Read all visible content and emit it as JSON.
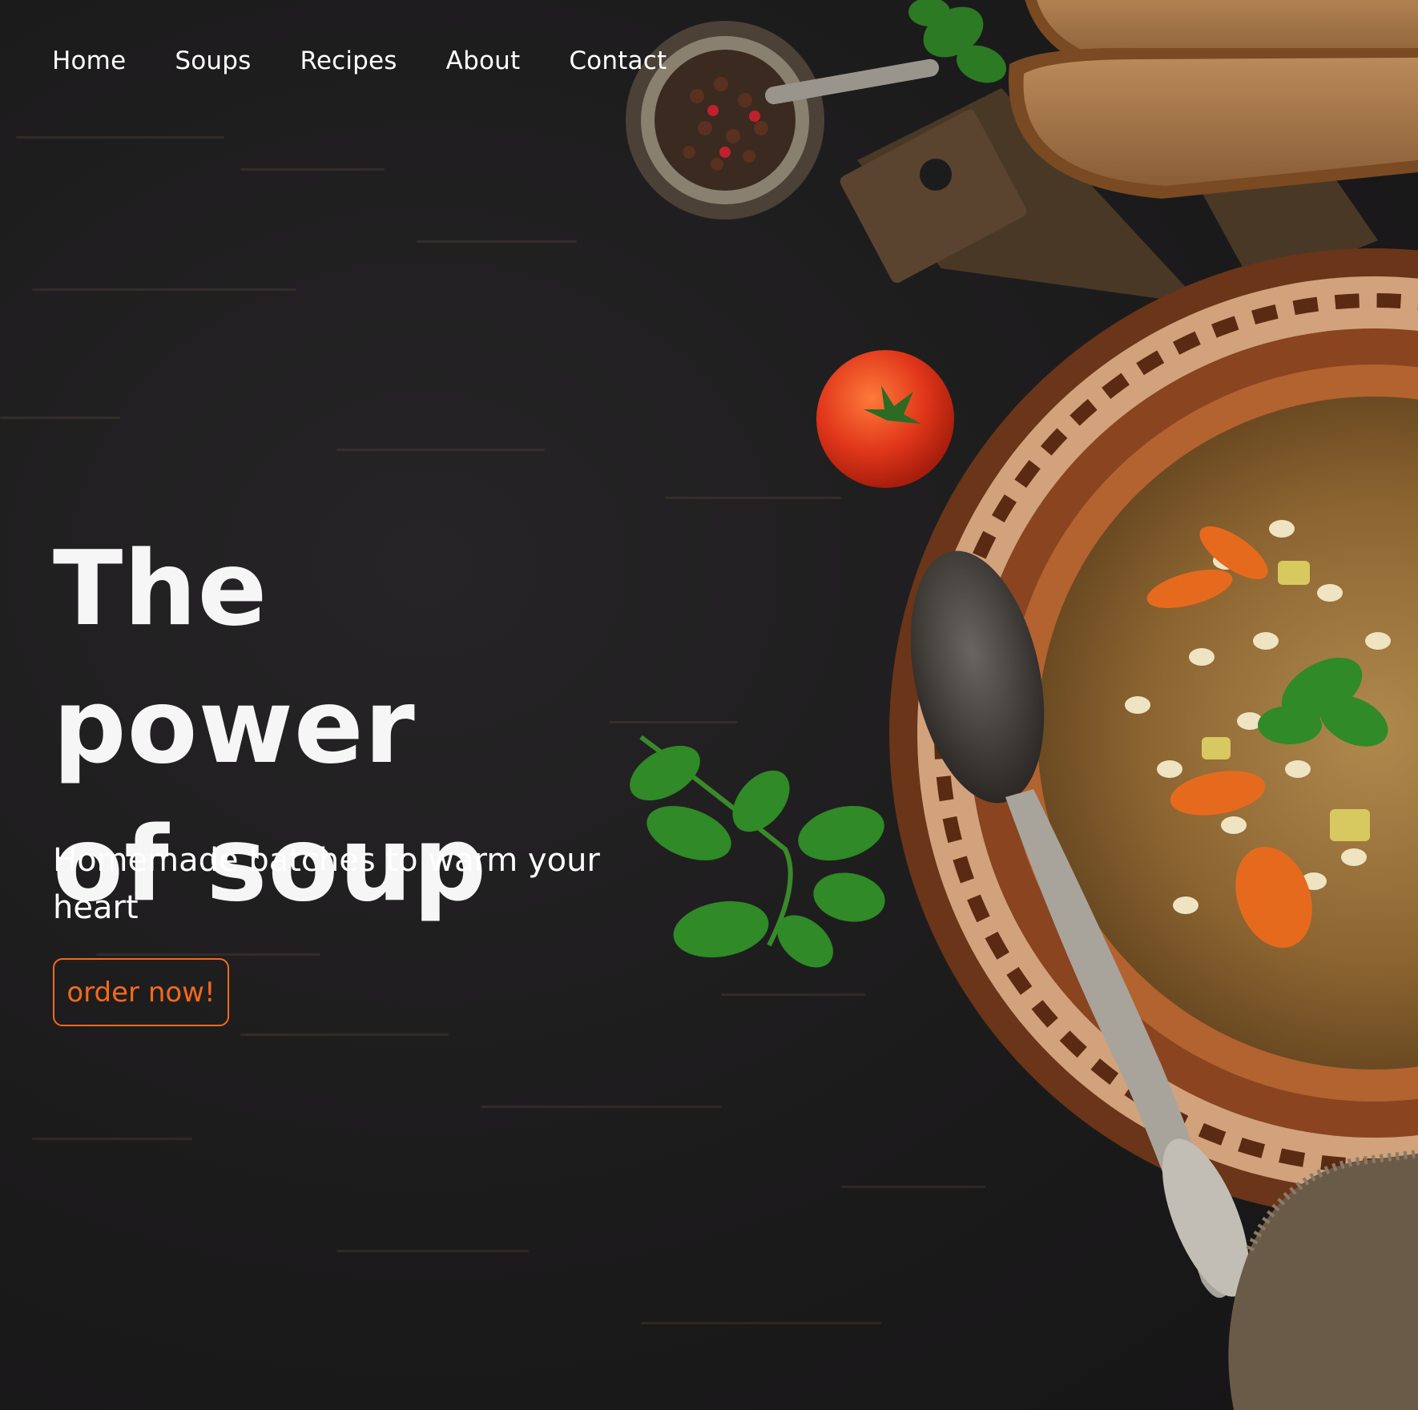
{
  "nav": {
    "items": [
      "Home",
      "Soups",
      "Recipes",
      "About",
      "Contact"
    ]
  },
  "hero": {
    "headline_line1": "The power",
    "headline_line2": "of soup",
    "subheadline": "Homemade batches to warm your heart",
    "cta_label": "order now!"
  },
  "colors": {
    "background": "#1d1c1d",
    "text": "#ffffff",
    "accent": "#f26a1b"
  },
  "imagery": {
    "background_photo": "overhead barley vegetable soup on dark wooden table",
    "items": [
      "pepper-jar-icon",
      "bread-slices-icon",
      "cutting-board-icon",
      "tomato-icon",
      "parsley-icon",
      "soup-bowl-icon",
      "spoon-icon",
      "burlap-cloth-icon"
    ]
  }
}
